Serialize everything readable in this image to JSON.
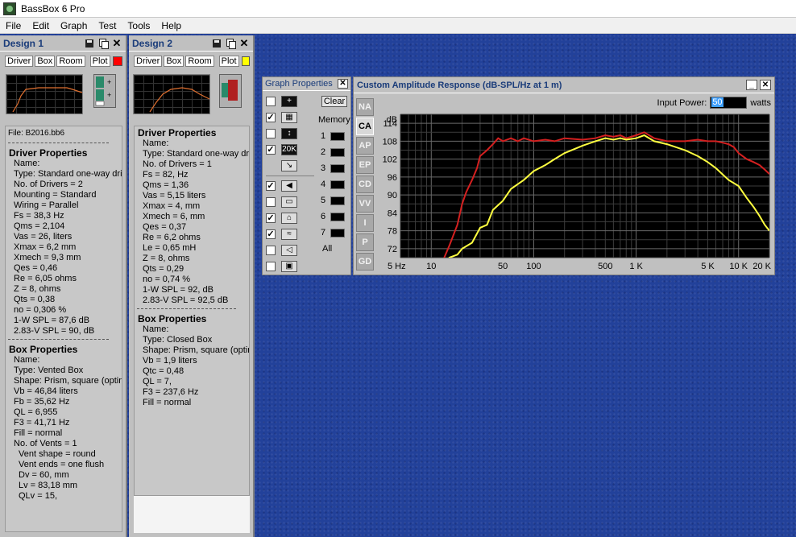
{
  "window": {
    "title": "BassBox 6 Pro"
  },
  "menu": [
    "File",
    "Edit",
    "Graph",
    "Test",
    "Tools",
    "Help"
  ],
  "design1": {
    "title": "Design 1",
    "tabs": {
      "driver": "Driver",
      "box": "Box",
      "room": "Room",
      "plot": "Plot"
    },
    "plot_color": "#ff0000",
    "file": "File: B2016.bb6",
    "driver_header": "Driver Properties",
    "driver_rows": [
      "Name:",
      "Type: Standard one-way driver",
      "No. of Drivers = 2",
      "Mounting = Standard",
      "Wiring = Parallel",
      "Fs = 38,3 Hz",
      "Qms = 2,104",
      "Vas = 26, liters",
      "Xmax = 6,2 mm",
      "Xmech = 9,3 mm",
      "Qes = 0,46",
      "Re = 6,05 ohms",
      "Z = 8, ohms",
      "Qts = 0,38",
      "no = 0,306 %",
      "1-W SPL = 87,6 dB",
      "2.83-V SPL = 90, dB"
    ],
    "box_header": "Box Properties",
    "box_rows": [
      "Name:",
      "Type: Vented Box",
      "Shape: Prism, square (optimum)",
      "Vb = 46,84 liters",
      "Fb = 35,62 Hz",
      "QL = 6,955",
      "F3 = 41,71 Hz",
      "Fill = normal",
      "No. of Vents = 1"
    ],
    "vent_rows": [
      "Vent shape = round",
      "Vent ends = one flush",
      "Dv = 60, mm",
      "Lv = 83,18 mm",
      "QLv = 15,"
    ]
  },
  "design2": {
    "title": "Design 2",
    "tabs": {
      "driver": "Driver",
      "box": "Box",
      "room": "Room",
      "plot": "Plot"
    },
    "plot_color": "#ffff00",
    "driver_header": "Driver Properties",
    "driver_rows": [
      "Name:",
      "Type: Standard one-way driver",
      "No. of Drivers = 1",
      "Fs = 82, Hz",
      "Qms = 1,36",
      "Vas = 5,15 liters",
      "Xmax = 4, mm",
      "Xmech = 6, mm",
      "Qes = 0,37",
      "Re = 6,2 ohms",
      "Le = 0,65 mH",
      "Z = 8, ohms",
      "Qts = 0,29",
      "no = 0,74 %",
      "1-W SPL = 92, dB",
      "2.83-V SPL = 92,5 dB"
    ],
    "box_header": "Box Properties",
    "box_rows": [
      "Name:",
      "Type: Closed Box",
      "Shape: Prism, square (optimum)",
      "Vb = 1,9 liters",
      "Qtc = 0,48",
      "QL = 7,",
      "F3 = 237,6 Hz",
      "Fill = normal"
    ]
  },
  "graph_properties": {
    "title": "Graph Properties",
    "clear": "Clear",
    "memory": "Memory",
    "memory_slots": [
      "1",
      "2",
      "3",
      "4",
      "5",
      "6",
      "7"
    ],
    "all": "All",
    "icon_20k": "20K"
  },
  "graph_window": {
    "title": "Custom Amplitude Response (dB-SPL/Hz at 1 m)",
    "input_power_label": "Input Power:",
    "input_power_value": "50",
    "input_power_unit": "watts",
    "tabs": [
      "NA",
      "CA",
      "AP",
      "EP",
      "CD",
      "VV",
      "I",
      "P",
      "GD"
    ],
    "active_tab": "CA"
  },
  "chart_data": {
    "type": "line",
    "ylabel": "dB",
    "x_scale": "log",
    "xlim": [
      5,
      20000
    ],
    "ylim": [
      69,
      117
    ],
    "x_tick_labels": [
      {
        "label": "5 Hz",
        "x": 5
      },
      {
        "label": "10",
        "x": 10
      },
      {
        "label": "50",
        "x": 50
      },
      {
        "label": "100",
        "x": 100
      },
      {
        "label": "500",
        "x": 500
      },
      {
        "label": "1 K",
        "x": 1000
      },
      {
        "label": "5 K",
        "x": 5000
      },
      {
        "label": "10 K",
        "x": 10000
      },
      {
        "label": "20 K",
        "x": 20000
      }
    ],
    "y_ticks": [
      72,
      78,
      84,
      90,
      96,
      102,
      108,
      114
    ],
    "grid": true,
    "background": "#000000",
    "series": [
      {
        "color": "#d42020",
        "x": [
          13,
          15,
          18,
          20,
          22,
          25,
          28,
          30,
          35,
          40,
          45,
          50,
          60,
          70,
          80,
          100,
          130,
          160,
          200,
          300,
          400,
          500,
          600,
          700,
          800,
          1000,
          1200,
          1500,
          2000,
          3000,
          4000,
          5000,
          6000,
          7000,
          8000,
          9000,
          10000,
          12000,
          14000,
          16000,
          18000,
          20000
        ],
        "y": [
          68,
          73,
          80,
          87,
          91,
          95,
          99,
          103,
          105,
          107,
          109,
          108,
          109,
          108,
          109,
          108,
          108.5,
          108,
          109,
          108.5,
          109,
          110,
          109.5,
          110,
          109,
          110,
          111,
          109,
          108,
          108,
          108.5,
          108,
          108,
          107.5,
          107,
          106,
          104,
          102,
          101,
          100,
          98.5,
          97
        ]
      },
      {
        "color": "#ffff40",
        "x": [
          13,
          15,
          18,
          20,
          25,
          30,
          35,
          40,
          50,
          60,
          80,
          100,
          130,
          160,
          200,
          300,
          400,
          500,
          600,
          700,
          800,
          1000,
          1200,
          1500,
          2000,
          3000,
          4000,
          5000,
          6000,
          8000,
          10000,
          12000,
          14000,
          16000,
          18000,
          20000
        ],
        "y": [
          66,
          69,
          70,
          72,
          74,
          79,
          80,
          85,
          88,
          92,
          95,
          98,
          100,
          102,
          104,
          106.5,
          108,
          109,
          108.5,
          109,
          108.5,
          109,
          110,
          108,
          107,
          105,
          103,
          101,
          99,
          95,
          93,
          89,
          86,
          83,
          80,
          78
        ]
      }
    ]
  }
}
